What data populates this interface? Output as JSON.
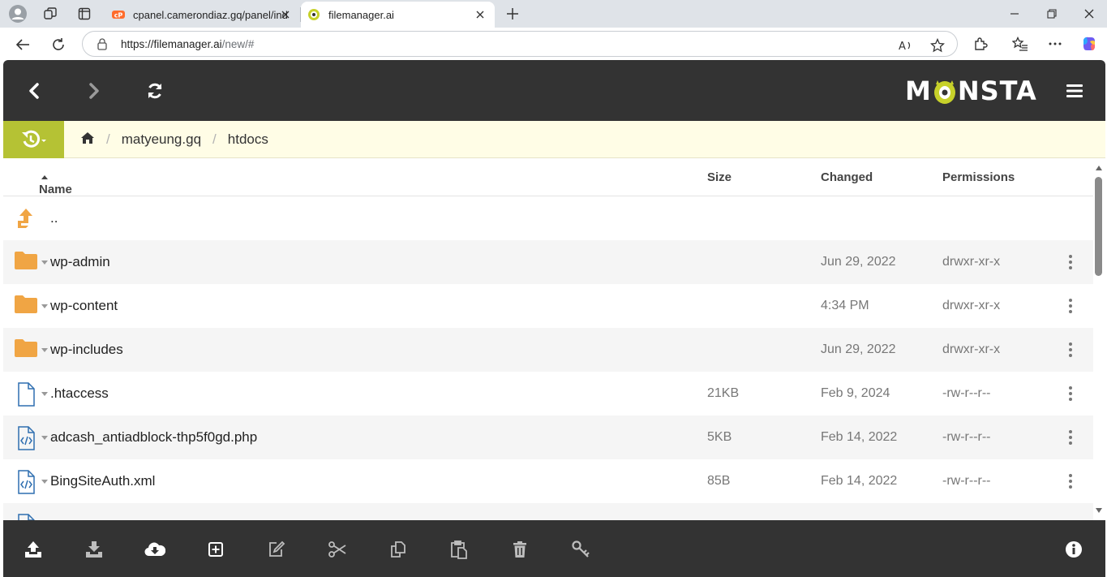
{
  "browser": {
    "tabs": [
      {
        "title": "cpanel.camerondiaz.gq/panel/ind",
        "active": false
      },
      {
        "title": "filemanager.ai",
        "active": true
      }
    ],
    "url_host": "https://filemanager.ai",
    "url_path": "/new/#"
  },
  "app": {
    "logo_left": "M",
    "logo_right": "NSTA",
    "breadcrumb": [
      "matyeung.gq",
      "htdocs"
    ],
    "breadcrumb_sep": "/",
    "columns": {
      "name": "Name",
      "size": "Size",
      "changed": "Changed",
      "permissions": "Permissions"
    },
    "parent_label": "..",
    "files": [
      {
        "name": "wp-admin",
        "type": "folder",
        "size": "",
        "changed": "Jun 29, 2022",
        "permissions": "drwxr-xr-x"
      },
      {
        "name": "wp-content",
        "type": "folder",
        "size": "",
        "changed": "4:34 PM",
        "permissions": "drwxr-xr-x"
      },
      {
        "name": "wp-includes",
        "type": "folder",
        "size": "",
        "changed": "Jun 29, 2022",
        "permissions": "drwxr-xr-x"
      },
      {
        "name": ".htaccess",
        "type": "file",
        "size": "21KB",
        "changed": "Feb 9, 2024",
        "permissions": "-rw-r--r--"
      },
      {
        "name": "adcash_antiadblock-thp5f0gd.php",
        "type": "code",
        "size": "5KB",
        "changed": "Feb 14, 2022",
        "permissions": "-rw-r--r--"
      },
      {
        "name": "BingSiteAuth.xml",
        "type": "code",
        "size": "85B",
        "changed": "Feb 14, 2022",
        "permissions": "-rw-r--r--"
      }
    ],
    "colors": {
      "topbar": "#333333",
      "accent_green": "#b5c234",
      "folder": "#f0a544",
      "code_icon": "#2f6fb0"
    }
  }
}
